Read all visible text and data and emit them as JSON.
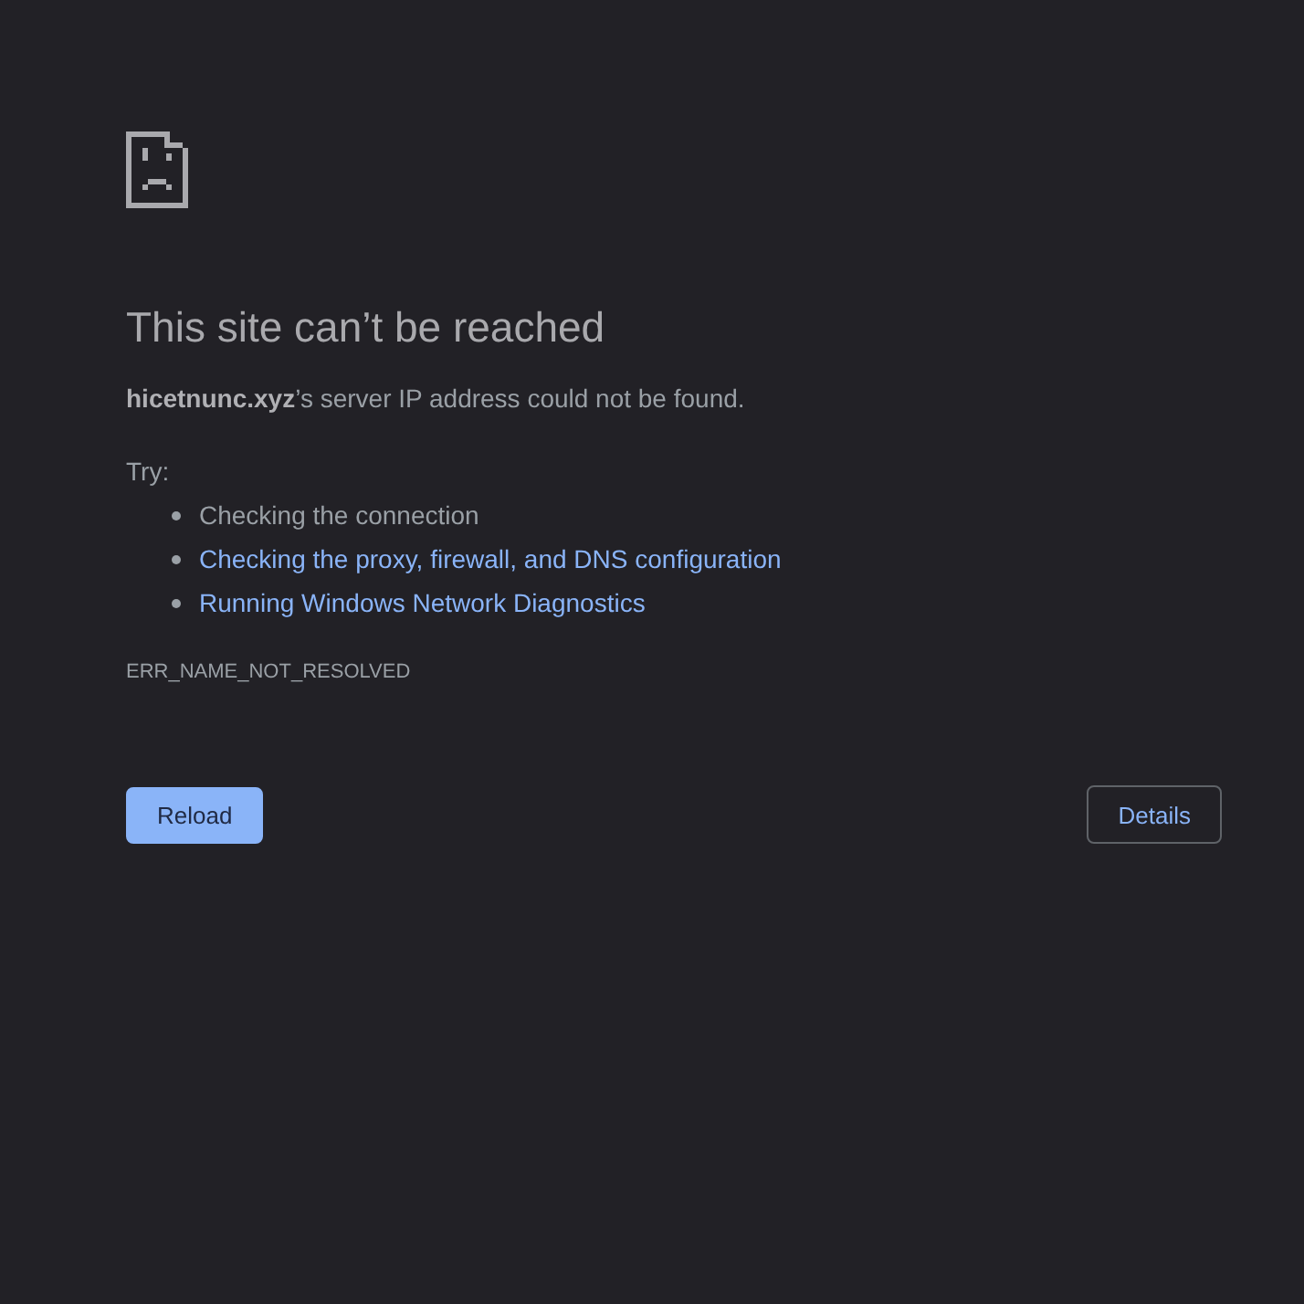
{
  "heading": "This site can’t be reached",
  "summary": "**hicetnunc.xyz**’s server IP address could not be found.",
  "suggestions_intro": "Try:",
  "suggestions": [
    {
      "text": "Checking the connection",
      "kind": "text"
    },
    {
      "text": "Checking the proxy, firewall, and DNS configuration",
      "kind": "link"
    },
    {
      "text": "Running Windows Network Diagnostics",
      "kind": "link"
    }
  ],
  "error_code": "ERR_NAME_NOT_RESOLVED",
  "buttons": [
    {
      "label": "Reload",
      "kind": "primary"
    },
    {
      "label": "Details",
      "kind": "secondary"
    }
  ]
}
